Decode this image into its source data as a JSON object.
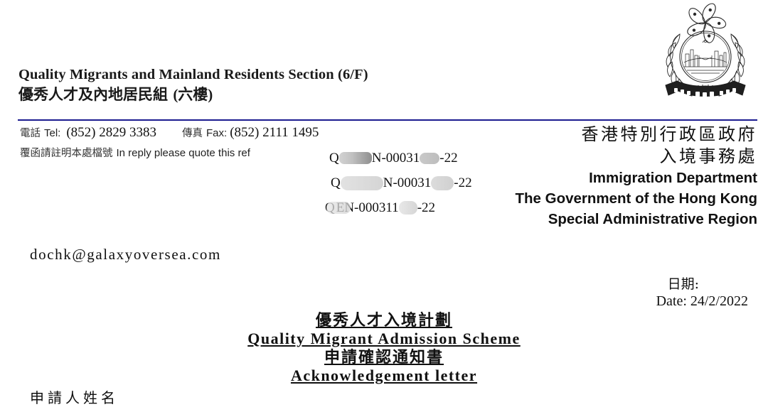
{
  "document": {
    "emblem_name": "hong-kong-immigration-department-crest"
  },
  "section_heading": {
    "english": "Quality Migrants and Mainland Residents Section (6/F)",
    "chinese": "優秀人才及內地居民組",
    "chinese_floor": "(六樓)"
  },
  "contact": {
    "tel_label_zh": "電話",
    "tel_label_en": "Tel:",
    "tel_value": "(852) 2829 3383",
    "fax_label_zh": "傳真",
    "fax_label_en": "Fax:",
    "fax_value": "(852) 2111 1495",
    "ref_label_zh": "覆函請註明本處檔號",
    "ref_label_en": "In reply please quote this ref"
  },
  "references": [
    {
      "prefix": "Q",
      "middle": "N-00031",
      "suffix": "-22"
    },
    {
      "prefix": "Q",
      "middle": "N-00031",
      "suffix": "-22"
    },
    {
      "prefix": "Q",
      "middle": "EN-000311",
      "suffix": "-22"
    }
  ],
  "government_block": {
    "line_zh_1": "香港特別行政區政府",
    "line_zh_2": "入境事務處",
    "line_en_1": "Immigration Department",
    "line_en_2": "The Government of the Hong Kong",
    "line_en_3": "Special Administrative Region"
  },
  "email": "dochk@galaxyoversea.com",
  "date": {
    "label_zh": "日期:",
    "label_en": "Date:",
    "value": "24/2/2022",
    "line_en": "Date: 24/2/2022"
  },
  "title": {
    "line1_zh": "優秀人才入境計劃",
    "line2_en": "Quality Migrant Admission Scheme",
    "line3_zh": "申請確認通知書",
    "line4_en": "Acknowledgement letter"
  },
  "body": {
    "first_line_zh": "申請人姓名"
  },
  "colors": {
    "rule": "#1b1b8f",
    "text": "#111111",
    "redaction": "#c9c9c9",
    "background": "#ffffff"
  }
}
